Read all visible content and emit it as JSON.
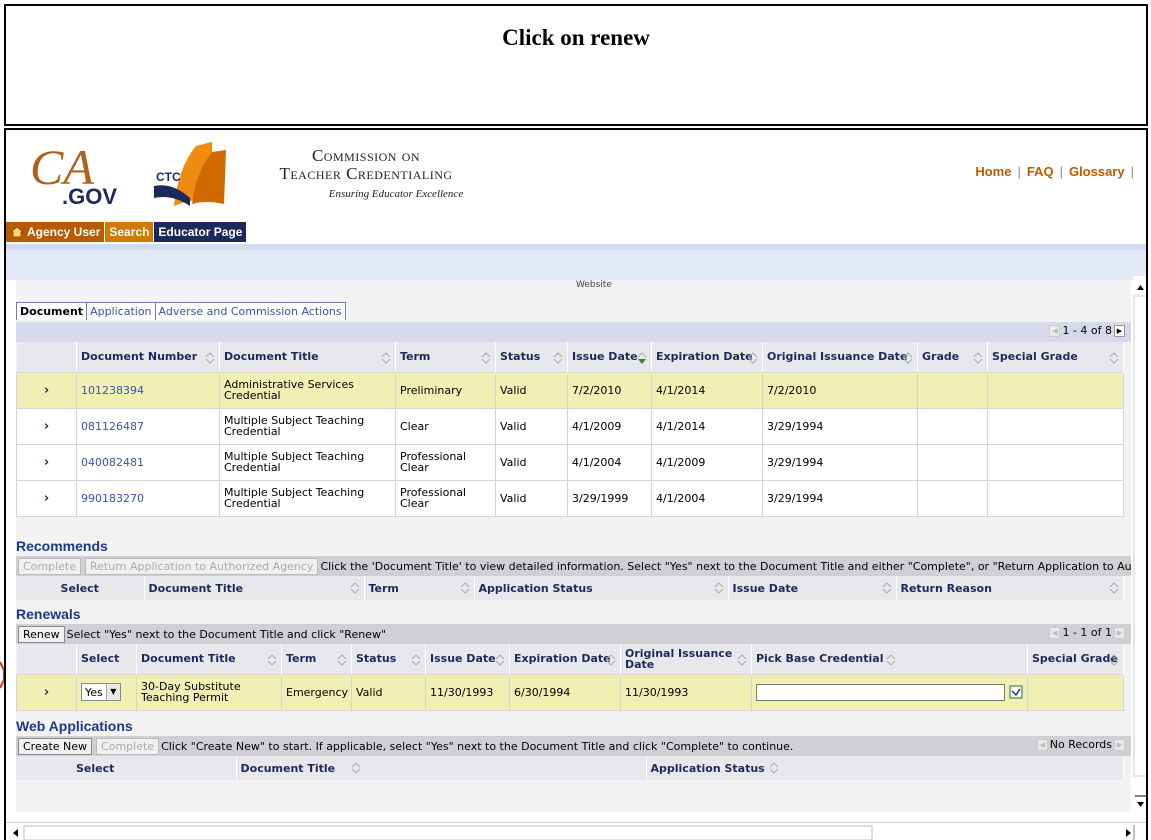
{
  "caption": "Click on renew",
  "header": {
    "agency_line1": "Commission on",
    "agency_line2": "Teacher Credentialing",
    "tagline": "Ensuring Educator Excellence",
    "logo_ca_text": "CA",
    "logo_gov_text": ".GOV",
    "logo_ctc_text": "CTC",
    "links": [
      "Home",
      "FAQ",
      "Glossary"
    ]
  },
  "nav": {
    "agency_user": "Agency User",
    "search": "Search",
    "educator_page": "Educator Page"
  },
  "website_label": "Website",
  "doc_tabs": [
    "Document",
    "Application",
    "Adverse and Commission Actions"
  ],
  "documents": {
    "pager": "1 - 4 of 8",
    "columns": [
      "Document Number",
      "Document Title",
      "Term",
      "Status",
      "Issue Date",
      "Expiration Date",
      "Original Issuance Date",
      "Grade",
      "Special Grade"
    ],
    "rows": [
      {
        "number": "101238394",
        "title": "Administrative Services Credential",
        "term": "Preliminary",
        "status": "Valid",
        "issue": "7/2/2010",
        "expiration": "4/1/2014",
        "original": "7/2/2010",
        "grade": "",
        "special": ""
      },
      {
        "number": "081126487",
        "title": "Multiple Subject Teaching Credential",
        "term": "Clear",
        "status": "Valid",
        "issue": "4/1/2009",
        "expiration": "4/1/2014",
        "original": "3/29/1994",
        "grade": "",
        "special": ""
      },
      {
        "number": "040082481",
        "title": "Multiple Subject Teaching Credential",
        "term": "Professional Clear",
        "status": "Valid",
        "issue": "4/1/2004",
        "expiration": "4/1/2009",
        "original": "3/29/1994",
        "grade": "",
        "special": ""
      },
      {
        "number": "990183270",
        "title": "Multiple Subject Teaching Credential",
        "term": "Professional Clear",
        "status": "Valid",
        "issue": "3/29/1999",
        "expiration": "4/1/2004",
        "original": "3/29/1994",
        "grade": "",
        "special": ""
      }
    ]
  },
  "recommends": {
    "title": "Recommends",
    "btn_complete": "Complete",
    "btn_return": "Return Application to Authorized Agency",
    "instructions": "Click the 'Document Title' to view detailed information. Select \"Yes\" next to the Document Title and either \"Complete\", or \"Return Application to Authorize",
    "columns": [
      "Select",
      "Document Title",
      "Term",
      "Application Status",
      "Issue Date",
      "Return Reason"
    ]
  },
  "renewals": {
    "title": "Renewals",
    "btn_renew": "Renew",
    "instructions": "Select \"Yes\" next to the Document Title and click \"Renew\"",
    "pager": "1 - 1 of 1",
    "columns": [
      "Select",
      "Document Title",
      "Term",
      "Status",
      "Issue Date",
      "Expiration Date",
      "Original Issuance Date",
      "Pick Base Credential",
      "Special Grade"
    ],
    "row": {
      "select": "Yes",
      "title": "30-Day Substitute Teaching Permit",
      "term": "Emergency",
      "status": "Valid",
      "issue": "11/30/1993",
      "expiration": "6/30/1994",
      "original": "11/30/1993",
      "base": "",
      "special": ""
    }
  },
  "web_applications": {
    "title": "Web Applications",
    "btn_create": "Create New",
    "btn_complete": "Complete",
    "instructions": "Click \"Create New\" to start. If applicable, select \"Yes\" next to the Document Title and click \"Complete\" to continue.",
    "pager": "No Records",
    "columns": [
      "Select",
      "Document Title",
      "Application Status"
    ]
  },
  "colors": {
    "accent_orange": "#c05a00",
    "navy": "#1c2a5a",
    "highlight_row": "#f0f0b4",
    "link_blue": "#3b54a8"
  }
}
